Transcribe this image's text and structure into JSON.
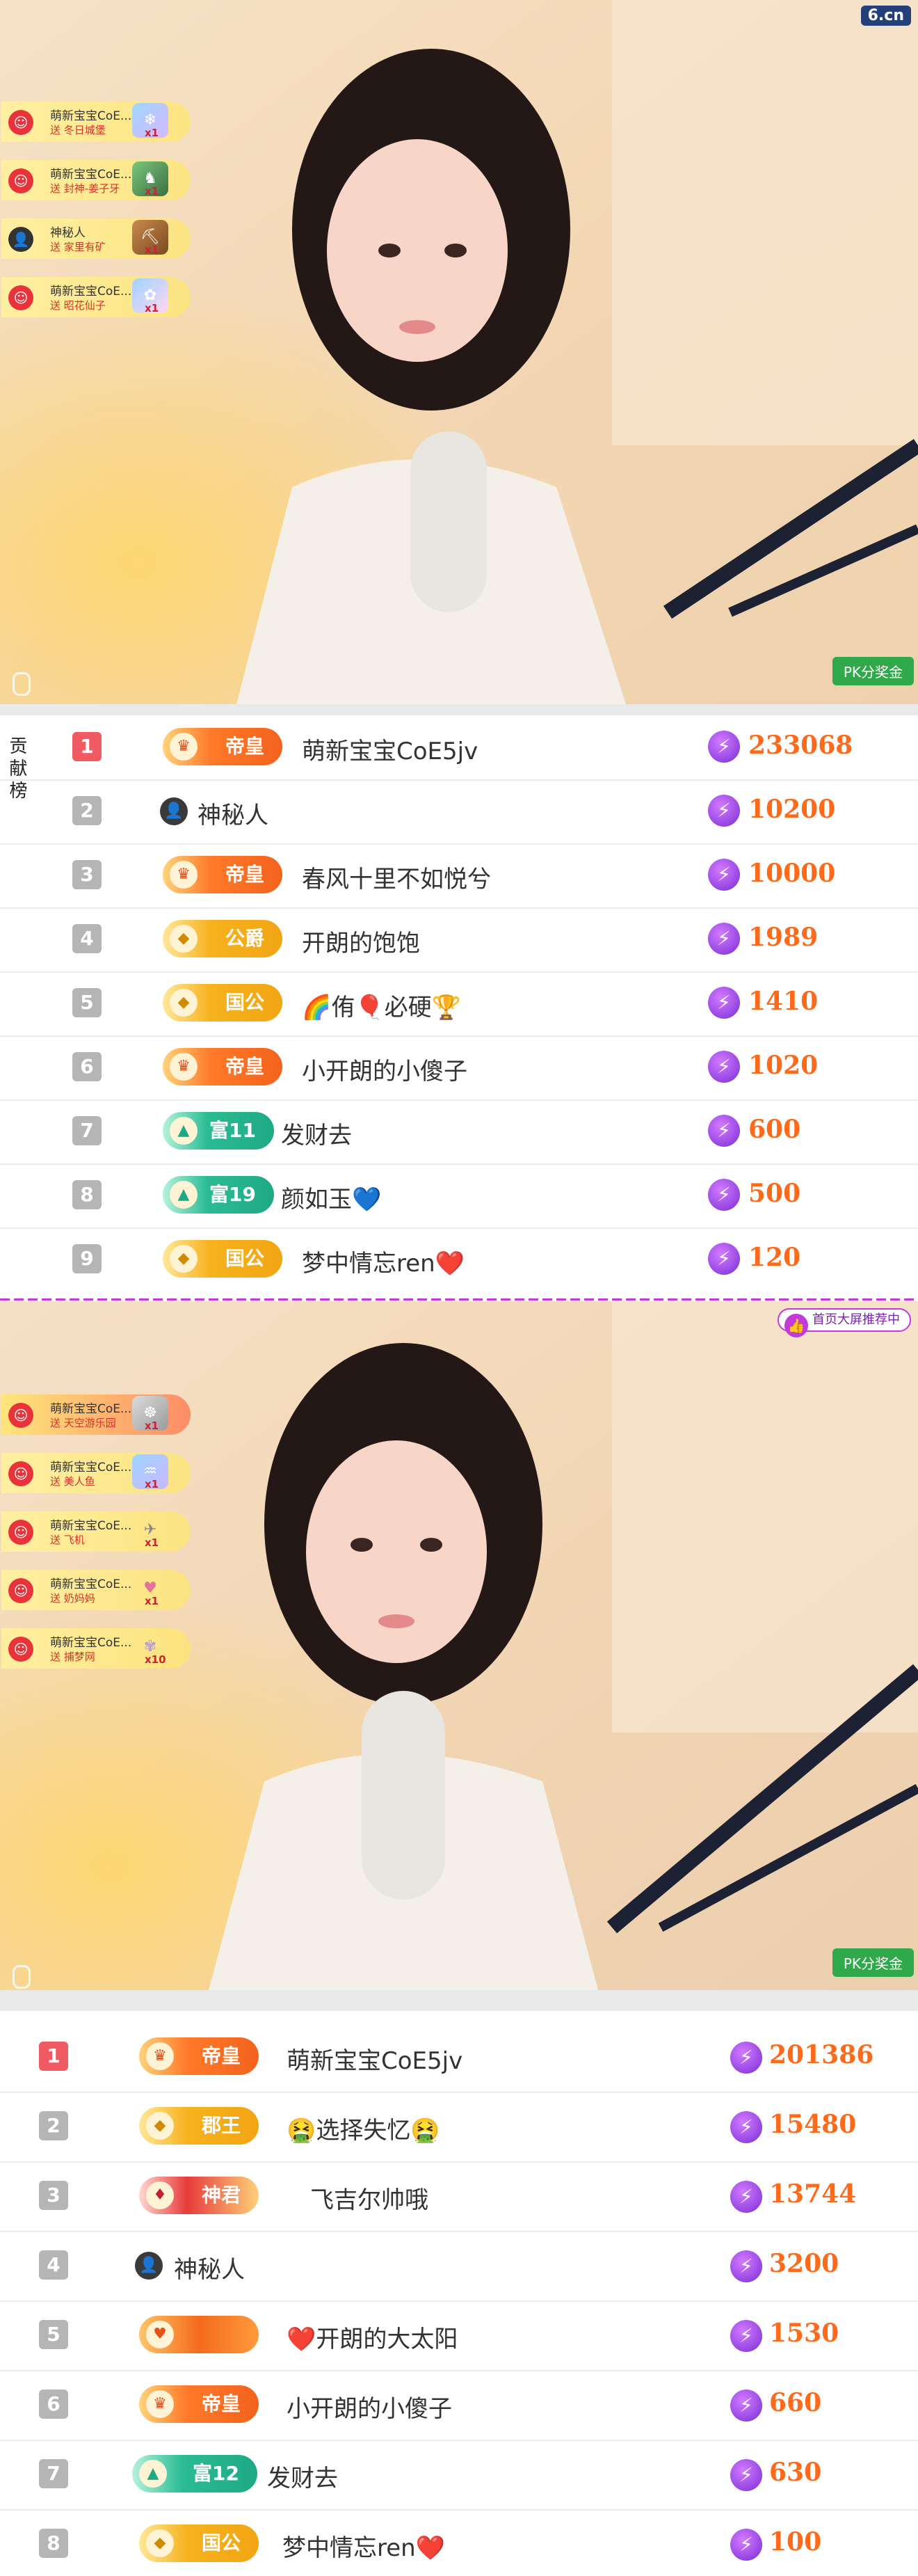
{
  "stream1": {
    "logo": "6.cn",
    "pk_button": "PK分奖金",
    "gifts": [
      {
        "name": "萌新宝宝CoE...",
        "sub": "送 冬日城堡",
        "qty": "x1"
      },
      {
        "name": "萌新宝宝CoE...",
        "sub": "送 封神-姜子牙",
        "qty": "x1"
      },
      {
        "name": "神秘人",
        "sub": "送 家里有矿",
        "qty": "x1"
      },
      {
        "name": "萌新宝宝CoE...",
        "sub": "送 昭花仙子",
        "qty": "x1"
      }
    ]
  },
  "board1": {
    "side_label": "贡献榜",
    "rows": [
      {
        "rank": "1",
        "badge": "帝皇",
        "name": "萌新宝宝CoE5jv",
        "amount": "233068"
      },
      {
        "rank": "2",
        "badge": "",
        "name": "神秘人",
        "amount": "10200"
      },
      {
        "rank": "3",
        "badge": "帝皇",
        "name": "春风十里不如悦兮",
        "amount": "10000"
      },
      {
        "rank": "4",
        "badge": "公爵",
        "name": "开朗的饱饱",
        "amount": "1989"
      },
      {
        "rank": "5",
        "badge": "国公",
        "name": "🌈侑🎈必硬🏆",
        "amount": "1410"
      },
      {
        "rank": "6",
        "badge": "帝皇",
        "name": "小开朗的小傻子",
        "amount": "1020"
      },
      {
        "rank": "7",
        "badge": "富11",
        "name": "发财去",
        "amount": "600"
      },
      {
        "rank": "8",
        "badge": "富19",
        "name": "颜如玉💙",
        "amount": "500"
      },
      {
        "rank": "9",
        "badge": "国公",
        "name": "梦中情忘ren❤️",
        "amount": "120"
      }
    ]
  },
  "stream2": {
    "promo": "首页大屏推荐中",
    "pk_button": "PK分奖金",
    "gifts": [
      {
        "name": "萌新宝宝CoE...",
        "sub": "送 天空游乐园",
        "qty": "x1"
      },
      {
        "name": "萌新宝宝CoE...",
        "sub": "送 美人鱼",
        "qty": "x1"
      },
      {
        "name": "萌新宝宝CoE...",
        "sub": "送 飞机",
        "qty": "x1"
      },
      {
        "name": "萌新宝宝CoE...",
        "sub": "送 奶妈妈",
        "qty": "x1"
      },
      {
        "name": "萌新宝宝CoE...",
        "sub": "送 捕梦网",
        "qty": "x10"
      }
    ]
  },
  "board2": {
    "rows": [
      {
        "rank": "1",
        "badge": "帝皇",
        "name": "萌新宝宝CoE5jv",
        "amount": "201386"
      },
      {
        "rank": "2",
        "badge": "郡王",
        "name": "🤮选择失忆🤮",
        "amount": "15480"
      },
      {
        "rank": "3",
        "badge": "神君",
        "name": "飞吉尔帅哦",
        "amount": "13744"
      },
      {
        "rank": "4",
        "badge": "",
        "name": "神秘人",
        "amount": "3200"
      },
      {
        "rank": "5",
        "badge": "",
        "name": "❤️开朗的大太阳",
        "amount": "1530"
      },
      {
        "rank": "6",
        "badge": "帝皇",
        "name": "小开朗的小傻子",
        "amount": "660"
      },
      {
        "rank": "7",
        "badge": "富12",
        "name": "发财去",
        "amount": "630"
      },
      {
        "rank": "8",
        "badge": "国公",
        "name": "梦中情忘ren❤️",
        "amount": "100"
      }
    ]
  },
  "icons": {
    "bolt": "⚡",
    "spy": "🕵",
    "crown": "♛"
  }
}
